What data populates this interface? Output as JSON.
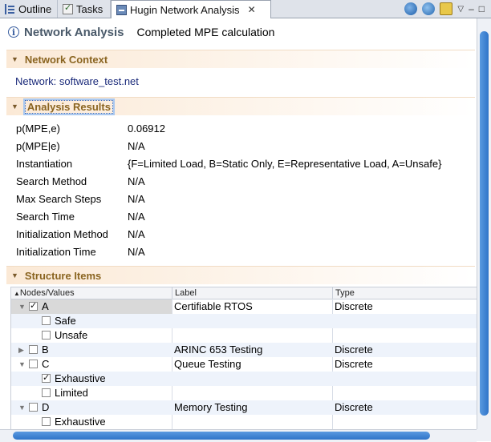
{
  "tabs": [
    {
      "label": "Outline",
      "icon": "outline-icon"
    },
    {
      "label": "Tasks",
      "icon": "tasks-icon"
    },
    {
      "label": "Hugin Network Analysis",
      "icon": "hugin-icon",
      "active": true
    }
  ],
  "toolbar": {
    "icons": [
      "sync-icon",
      "sync-alt-icon",
      "pin-icon",
      "view-menu-icon",
      "minimize-icon",
      "maximize-icon"
    ],
    "minimize_glyph": "–",
    "maximize_glyph": "□"
  },
  "header": {
    "title": "Network Analysis",
    "status": "Completed MPE calculation"
  },
  "sections": {
    "network_context": {
      "title": "Network Context",
      "network_label": "Network: software_test.net"
    },
    "analysis_results": {
      "title": "Analysis Results",
      "rows": [
        {
          "key": "p(MPE,e)",
          "value": "0.06912"
        },
        {
          "key": "p(MPE|e)",
          "value": "N/A"
        },
        {
          "key": "Instantiation",
          "value": "{F=Limited Load, B=Static Only, E=Representative Load, A=Unsafe}"
        },
        {
          "key": "Search Method",
          "value": "N/A"
        },
        {
          "key": "Max Search Steps",
          "value": "N/A"
        },
        {
          "key": "Search Time",
          "value": "N/A"
        },
        {
          "key": "Initialization Method",
          "value": "N/A"
        },
        {
          "key": "Initialization Time",
          "value": "N/A"
        }
      ]
    },
    "structure_items": {
      "title": "Structure Items",
      "columns": [
        "Nodes/Values",
        "Label",
        "Type"
      ],
      "rows": [
        {
          "name": "A",
          "label": "Certifiable RTOS",
          "type": "Discrete",
          "level": 0,
          "expanded": true,
          "checked": true
        },
        {
          "name": "Safe",
          "label": "",
          "type": "",
          "level": 1,
          "checked": false
        },
        {
          "name": "Unsafe",
          "label": "",
          "type": "",
          "level": 1,
          "checked": false
        },
        {
          "name": "B",
          "label": "ARINC 653 Testing",
          "type": "Discrete",
          "level": 0,
          "expanded": false,
          "checked": false
        },
        {
          "name": "C",
          "label": "Queue Testing",
          "type": "Discrete",
          "level": 0,
          "expanded": true,
          "checked": false
        },
        {
          "name": "Exhaustive",
          "label": "",
          "type": "",
          "level": 1,
          "checked": true
        },
        {
          "name": "Limited",
          "label": "",
          "type": "",
          "level": 1,
          "checked": false
        },
        {
          "name": "D",
          "label": "Memory Testing",
          "type": "Discrete",
          "level": 0,
          "expanded": true,
          "checked": false
        },
        {
          "name": "Exhaustive",
          "label": "",
          "type": "",
          "level": 1,
          "checked": false
        }
      ]
    }
  }
}
